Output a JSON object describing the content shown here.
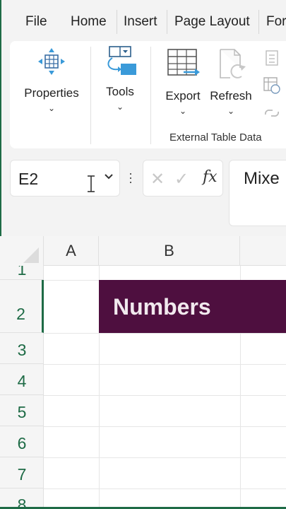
{
  "menu": {
    "items": [
      "File",
      "Home",
      "Insert",
      "Page Layout",
      "For"
    ]
  },
  "ribbon": {
    "buttons": {
      "properties": "Properties",
      "tools": "Tools",
      "export": "Export",
      "refresh": "Refresh"
    },
    "group_label": "External Table Data"
  },
  "formula_bar": {
    "name_box": "E2",
    "fx_label": "fx",
    "formula_value": "Mixe"
  },
  "grid": {
    "columns": [
      "A",
      "B"
    ],
    "rows": [
      "1",
      "2",
      "3",
      "4",
      "5",
      "6",
      "7",
      "8"
    ],
    "header_cell_text": "Numbers"
  },
  "colors": {
    "accent_green": "#1e6b46",
    "header_fill": "#4e0f3f",
    "header_text": "#f1e9ee"
  }
}
